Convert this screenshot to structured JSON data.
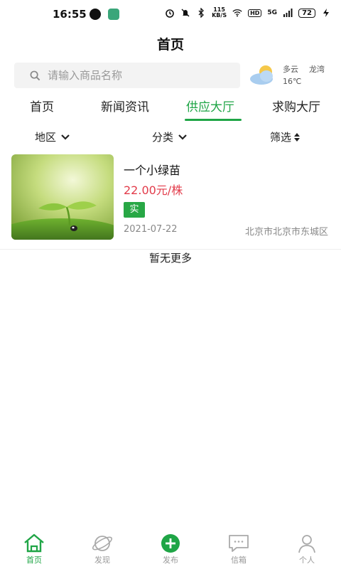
{
  "status_bar": {
    "time": "16:55",
    "net_speed_top": "115",
    "net_speed_bottom": "KB/S",
    "hd": "HD",
    "signal": "5G",
    "battery": "72"
  },
  "header": {
    "title": "首页"
  },
  "search": {
    "placeholder": "请输入商品名称"
  },
  "weather": {
    "condition": "多云",
    "city": "龙湾",
    "temperature": "16℃"
  },
  "tabs": [
    {
      "label": "首页",
      "active": false
    },
    {
      "label": "新闻资讯",
      "active": false
    },
    {
      "label": "供应大厅",
      "active": true
    },
    {
      "label": "求购大厅",
      "active": false
    }
  ],
  "filters": [
    {
      "label": "地区",
      "icon": "chevron-down-icon"
    },
    {
      "label": "分类",
      "icon": "chevron-down-icon"
    },
    {
      "label": "筛选",
      "icon": "sort-icon"
    }
  ],
  "items": [
    {
      "name": "一个小绿苗",
      "price": "22.00元/株",
      "tag": "实",
      "date": "2021-07-22",
      "location": "北京市北京市东城区"
    }
  ],
  "list_footer": "暂无更多",
  "bottom_nav": [
    {
      "label": "首页",
      "icon": "home-icon",
      "active": true
    },
    {
      "label": "发现",
      "icon": "planet-icon",
      "active": false
    },
    {
      "label": "发布",
      "icon": "plus-circle-icon",
      "active": false
    },
    {
      "label": "信箱",
      "icon": "message-icon",
      "active": false
    },
    {
      "label": "个人",
      "icon": "person-icon",
      "active": false
    }
  ],
  "colors": {
    "accent": "#1fa546",
    "price": "#e23b4a",
    "tag_bg": "#28a745"
  }
}
